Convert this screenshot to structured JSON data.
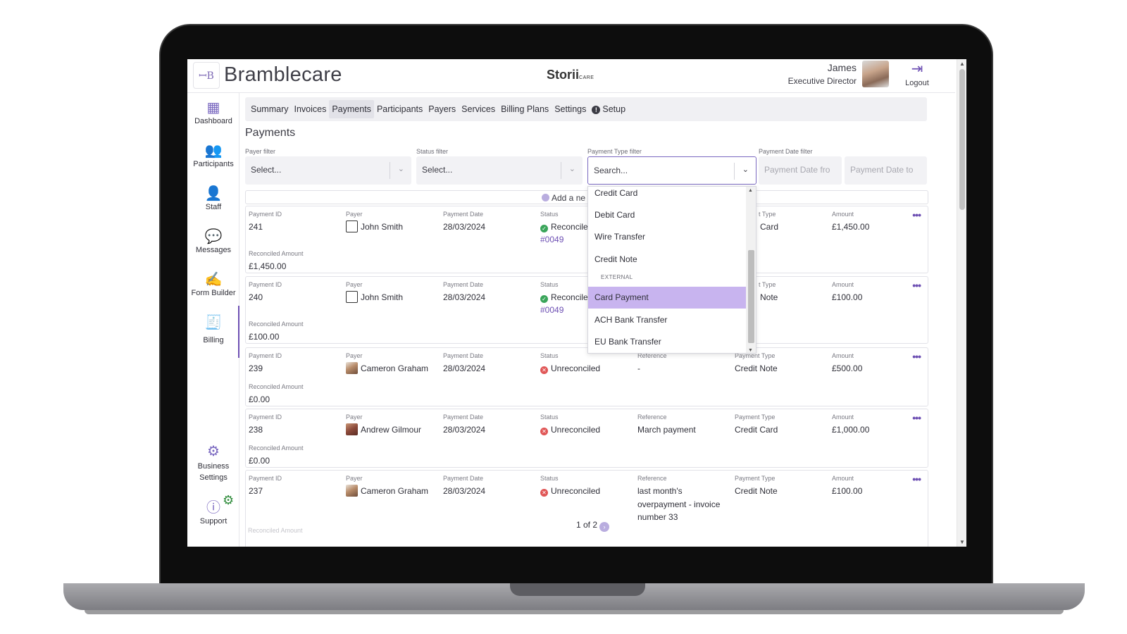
{
  "app": {
    "brand": "Bramblecare",
    "logo_text": "ꟷB",
    "product": "Storii",
    "product_sub": "CARE"
  },
  "user": {
    "name": "James",
    "role": "Executive Director",
    "logout_label": "Logout"
  },
  "sidebar": {
    "items": [
      {
        "label": "Dashboard",
        "icon": "dashboard-icon"
      },
      {
        "label": "Participants",
        "icon": "participants-icon"
      },
      {
        "label": "Staff",
        "icon": "staff-icon"
      },
      {
        "label": "Messages",
        "icon": "messages-icon"
      },
      {
        "label": "Form Builder",
        "icon": "form-builder-icon"
      },
      {
        "label": "Billing",
        "icon": "billing-icon"
      }
    ],
    "business_settings": "Business Settings",
    "support": "Support"
  },
  "tabs": [
    "Summary",
    "Invoices",
    "Payments",
    "Participants",
    "Payers",
    "Services",
    "Billing Plans",
    "Settings",
    "Setup"
  ],
  "active_tab": "Payments",
  "page_title": "Payments",
  "filters": {
    "payer": {
      "label": "Payer filter",
      "placeholder": "Select..."
    },
    "status": {
      "label": "Status filter",
      "placeholder": "Select..."
    },
    "payment_type": {
      "label": "Payment Type filter",
      "placeholder": "Search..."
    },
    "date": {
      "label": "Payment Date filter",
      "from_placeholder": "Payment Date fro",
      "to_placeholder": "Payment Date to"
    }
  },
  "add_new_label": "Add a ne",
  "column_labels": {
    "payment_id": "Payment ID",
    "payer": "Payer",
    "payment_date": "Payment Date",
    "status": "Status",
    "reference": "Reference",
    "payment_type": "Payment Type",
    "payment_type_partial": "t Type",
    "amount": "Amount",
    "reconciled_amount": "Reconciled Amount"
  },
  "payments": [
    {
      "id": "241",
      "payer": "John Smith",
      "date": "28/03/2024",
      "status": "Reconcile",
      "invoice": "#0049",
      "type": "Card",
      "amount": "£1,450.00",
      "reconciled": "£1,450.00"
    },
    {
      "id": "240",
      "payer": "John Smith",
      "date": "28/03/2024",
      "status": "Reconcile",
      "invoice": "#0049",
      "type": "Note",
      "amount": "£100.00",
      "reconciled": "£100.00"
    },
    {
      "id": "239",
      "payer": "Cameron Graham",
      "date": "28/03/2024",
      "status": "Unreconciled",
      "reference": "-",
      "type": "Credit Note",
      "amount": "£500.00",
      "reconciled": "£0.00"
    },
    {
      "id": "238",
      "payer": "Andrew Gilmour",
      "date": "28/03/2024",
      "status": "Unreconciled",
      "reference": "March payment",
      "type": "Credit Card",
      "amount": "£1,000.00",
      "reconciled": "£0.00"
    },
    {
      "id": "237",
      "payer": "Cameron Graham",
      "date": "28/03/2024",
      "status": "Unreconciled",
      "reference_lines": [
        "last month's",
        "overpayment - invoice",
        "number 33"
      ],
      "type": "Credit Note",
      "amount": "£100.00"
    }
  ],
  "dropdown": {
    "items_top": [
      "Credit Card",
      "Debit Card",
      "Wire Transfer",
      "Credit Note"
    ],
    "group_label": "EXTERNAL",
    "items_external": [
      "Card Payment",
      "ACH Bank Transfer",
      "EU Bank Transfer"
    ],
    "highlighted": "Card Payment"
  },
  "pagination": {
    "text": "1 of 2"
  },
  "more_icon": "more-horizontal-icon",
  "colors": {
    "accent": "#6d4fb3",
    "highlight": "#c8b4ef",
    "success": "#3aa55a",
    "danger": "#e05656"
  }
}
